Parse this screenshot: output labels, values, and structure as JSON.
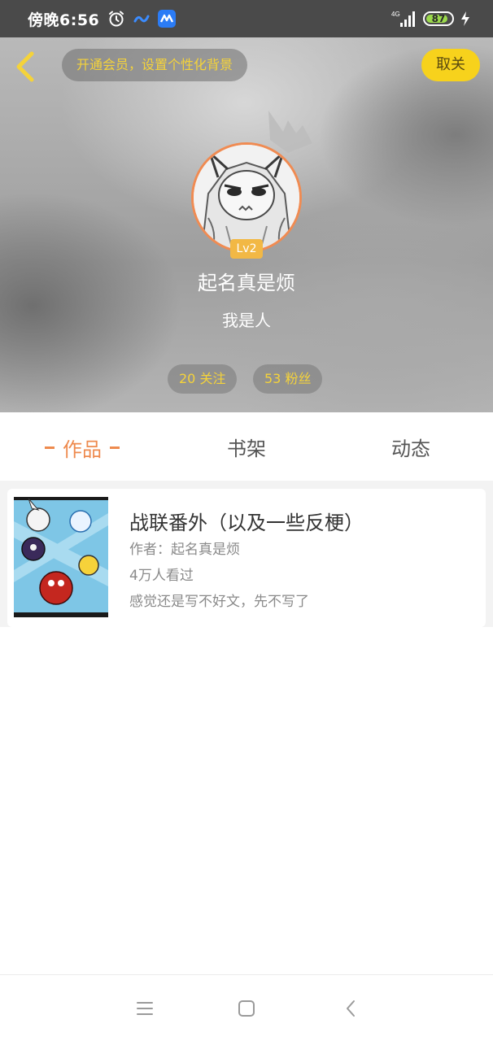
{
  "status_bar": {
    "time": "傍晚6:56",
    "network": "4G",
    "battery": "87",
    "battery_level": 0.87,
    "icons": [
      "alarm-icon",
      "mini-app-icon",
      "app-badge-icon",
      "signal-icon",
      "battery-icon",
      "charging-bolt-icon"
    ]
  },
  "header": {
    "member_banner": "开通会员，设置个性化背景",
    "unfollow_label": "取关",
    "level": "Lv2",
    "username": "起名真是烦",
    "bio": "我是人",
    "following": "20 关注",
    "followers": "53 粉丝",
    "accent_color": "#f7d21c"
  },
  "tabs": [
    {
      "label": "作品",
      "active": true
    },
    {
      "label": "书架",
      "active": false
    },
    {
      "label": "动态",
      "active": false
    }
  ],
  "works": [
    {
      "title": "战联番外（以及一些反梗）",
      "author": "作者：起名真是烦",
      "views": "4万人看过",
      "description": "感觉还是写不好文，先不写了"
    }
  ],
  "nav": {
    "icons": [
      "menu-icon",
      "home-icon",
      "back-arrow-icon"
    ]
  },
  "colors": {
    "active_tab": "#ee8a4e",
    "banner_text": "#f5d33a",
    "level_badge": "#f2b845"
  }
}
